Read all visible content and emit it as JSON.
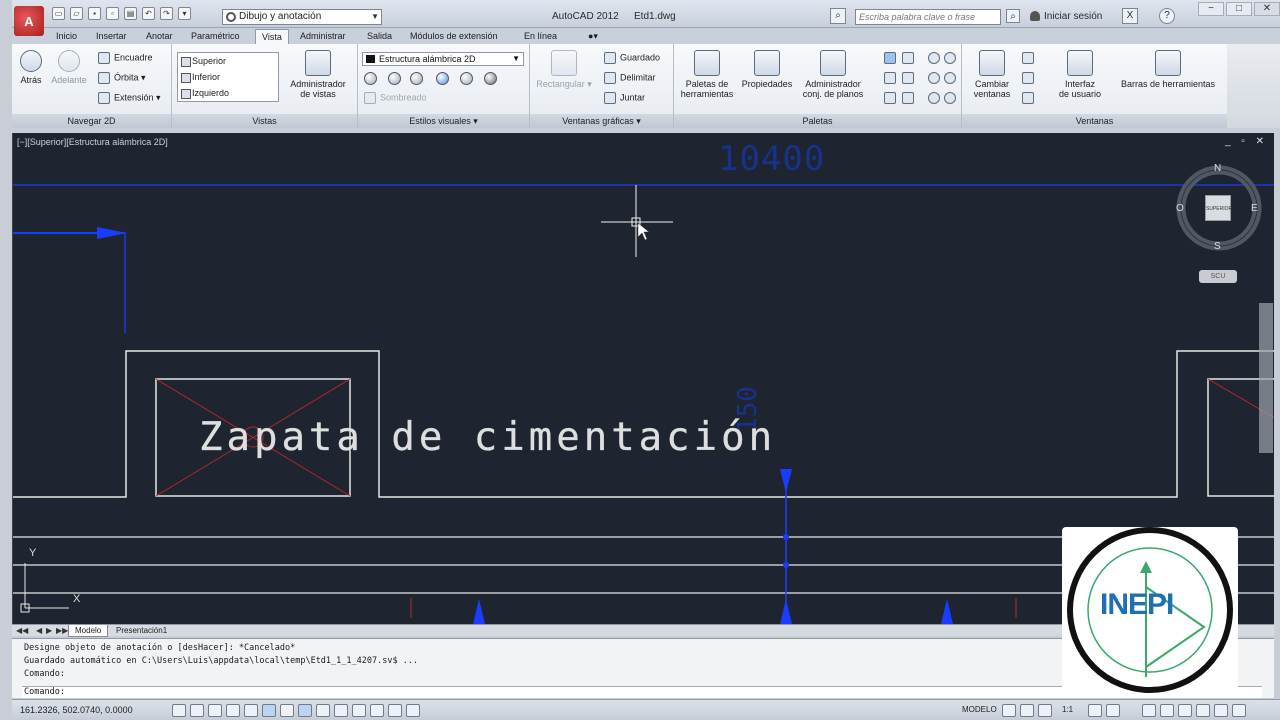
{
  "title_bar": {
    "app_title": "AutoCAD 2012",
    "file_name": "Etd1.dwg",
    "workspace": "Dibujo y anotación",
    "search_placeholder": "Escriba palabra clave o frase",
    "login_label": "Iniciar sesión",
    "window_controls": [
      "−",
      "□",
      "✕"
    ]
  },
  "tabs": [
    "Inicio",
    "Insertar",
    "Anotar",
    "Paramétrico",
    "Vista",
    "Administrar",
    "Salida",
    "Módulos de extensión",
    "En línea"
  ],
  "active_tab": "Vista",
  "ribbon": {
    "navegar": {
      "title": "Navegar 2D",
      "back": "Atrás",
      "forward": "Adelante",
      "pan": "Encuadre",
      "orbit": "Órbita",
      "extents": "Extensión"
    },
    "vistas": {
      "title": "Vistas",
      "list": [
        "Superior",
        "Inferior",
        "Izquierdo"
      ],
      "manager": [
        "Administrador",
        "de vistas"
      ]
    },
    "estilos": {
      "title": "Estilos visuales",
      "current": "Estructura alámbrica 2D",
      "disabled_label": "Sombreado"
    },
    "ventanas": {
      "title": "Ventanas gráficas",
      "rect": "Rectangular",
      "save": "Guardado",
      "clip": "Delimitar",
      "join": "Juntar"
    },
    "paletas": {
      "title": "Paletas",
      "tool_palettes": [
        "Paletas de",
        "herramientas"
      ],
      "properties": "Propiedades",
      "sheet_set": [
        "Administrador",
        "conj. de planos"
      ]
    },
    "ventanas_panel": {
      "title": "Ventanas",
      "switch": [
        "Cambiar",
        "ventanas"
      ],
      "ui": [
        "Interfaz",
        "de usuario"
      ],
      "toolbars": "Barras de herramientas"
    }
  },
  "viewport": {
    "label": "[−][Superior][Estructura alámbrica 2D]",
    "controls": "_ ▫ ✕",
    "title_text": "Zapata de cimentación",
    "dim_top": "10400",
    "dim_vertical": "150",
    "compass": {
      "n": "N",
      "s": "S",
      "e": "E",
      "o": "O",
      "top": "SUPERIOR",
      "wcs": "SCU"
    },
    "ucs": {
      "x": "X",
      "y": "Y"
    }
  },
  "layout_tabs": [
    "Modelo",
    "Presentación1"
  ],
  "active_layout_tab": "Modelo",
  "command_line": {
    "history": [
      "Designe objeto de anotación o [desHacer]: *Cancelado*",
      "Guardado automático en C:\\Users\\Luis\\appdata\\local\\temp\\Etd1_1_1_4207.sv$ ...",
      "Comando:"
    ],
    "prompt": "Comando:"
  },
  "status_bar": {
    "coordinates": "161.2326, 502.0740, 0.0000",
    "model": "MODELO",
    "scale": "1:1"
  },
  "watermark": {
    "text": "INEPI"
  },
  "colors": {
    "drawing_bg": "#1e2530",
    "geometry": "#e6e6e6",
    "dimension": "#1a3cff",
    "hatch_red": "#b2262b",
    "watermark_blue": "#1f6fb1"
  }
}
